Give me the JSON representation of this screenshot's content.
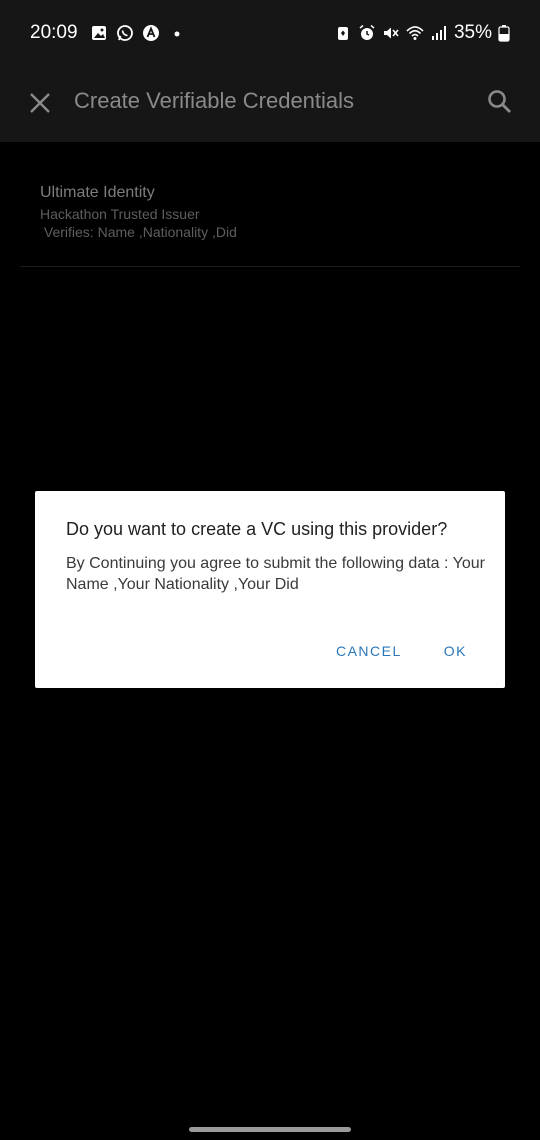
{
  "status_bar": {
    "time": "20:09",
    "battery": "35%",
    "left_icons": [
      "gallery-icon",
      "whatsapp-icon",
      "app-a-icon",
      "dot-icon"
    ],
    "right_icons": [
      "battery-saver-icon",
      "alarm-icon",
      "mute-icon",
      "wifi-icon",
      "signal-icon",
      "battery-icon"
    ]
  },
  "app_bar": {
    "title": "Create Verifiable Credentials"
  },
  "providers": [
    {
      "title": "Ultimate Identity",
      "subtitle": "Hackathon Trusted Issuer",
      "verifies": " Verifies: Name ,Nationality ,Did"
    }
  ],
  "dialog": {
    "title": "Do you want to create a VC using this provider?",
    "body": "By Continuing you agree to submit the following data : Your Name ,Your Nationality ,Your Did",
    "cancel_label": "CANCEL",
    "ok_label": "OK"
  },
  "colors": {
    "background": "#000000",
    "app_bar": "#161616",
    "dialog_button": "#2b77b8"
  }
}
